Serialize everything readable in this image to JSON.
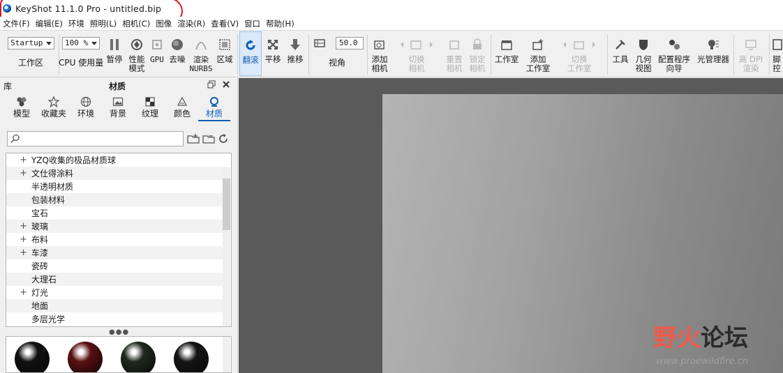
{
  "window": {
    "title": "KeyShot 11.1.0 Pro  - untitled.bip"
  },
  "menu": [
    "文件(F)",
    "编辑(E)",
    "环境",
    "照明(L)",
    "相机(C)",
    "图像",
    "渲染(R)",
    "查看(V)",
    "窗口",
    "帮助(H)"
  ],
  "toolbar": {
    "workspace_select": "Startup",
    "workspace_label": "工作区",
    "cpu_select": "100 %",
    "cpu_label": "CPU 使用量",
    "pause": "暂停",
    "perf_mode": "性能\n模式",
    "gpu": "GPU",
    "denoise": "去噪",
    "render_nurbs": "渲染\nNURBS",
    "region": "区域",
    "tumble": "翻滚",
    "pan": "平移",
    "dolly": "推移",
    "fov_value": "50.0",
    "fov_label": "视角",
    "add_camera": "添加\n相机",
    "switch_camera": "切换\n相机",
    "reset_camera": "重置\n相机",
    "lock_camera": "锁定\n相机",
    "studio": "工作室",
    "add_studio": "添加\n工作室",
    "switch_studio": "切换\n工作室",
    "tools": "工具",
    "geometry_view": "几何\n视图",
    "config_wizard": "配置程序\n向导",
    "light_manager": "光管理器",
    "hi_dpi": "高 DPI\n渲染",
    "script_console": "脚\n控"
  },
  "library": {
    "panel_title_left": "库",
    "panel_title": "材质",
    "tabs": [
      {
        "label": "模型",
        "icon": "model-icon"
      },
      {
        "label": "收藏夹",
        "icon": "star-icon"
      },
      {
        "label": "环境",
        "icon": "globe-icon"
      },
      {
        "label": "背景",
        "icon": "image-icon"
      },
      {
        "label": "纹理",
        "icon": "checker-icon"
      },
      {
        "label": "颜色",
        "icon": "palette-icon"
      },
      {
        "label": "材质",
        "icon": "material-icon"
      }
    ],
    "search_placeholder": "",
    "tree": [
      {
        "label": "YZQ收集的极品材质球",
        "expandable": true
      },
      {
        "label": "文仕得涂料",
        "expandable": true
      },
      {
        "label": "半透明材质",
        "expandable": false
      },
      {
        "label": "包装材料",
        "expandable": false
      },
      {
        "label": "宝石",
        "expandable": false
      },
      {
        "label": "玻璃",
        "expandable": true
      },
      {
        "label": "布料",
        "expandable": true
      },
      {
        "label": "车漆",
        "expandable": true
      },
      {
        "label": "瓷砖",
        "expandable": false
      },
      {
        "label": "大理石",
        "expandable": false
      },
      {
        "label": "灯光",
        "expandable": true
      },
      {
        "label": "地面",
        "expandable": false
      },
      {
        "label": "多层光学",
        "expandable": false
      }
    ],
    "thumbnail_colors": [
      "#111111",
      "#5a0f10",
      "#1f2a1f",
      "#151515"
    ]
  },
  "watermark": {
    "text_a": "野火",
    "text_b": "论坛",
    "url": "www.proewildfire.cn"
  },
  "colors": {
    "accent": "#0f5db3",
    "highlight_circle": "#e0161f"
  }
}
